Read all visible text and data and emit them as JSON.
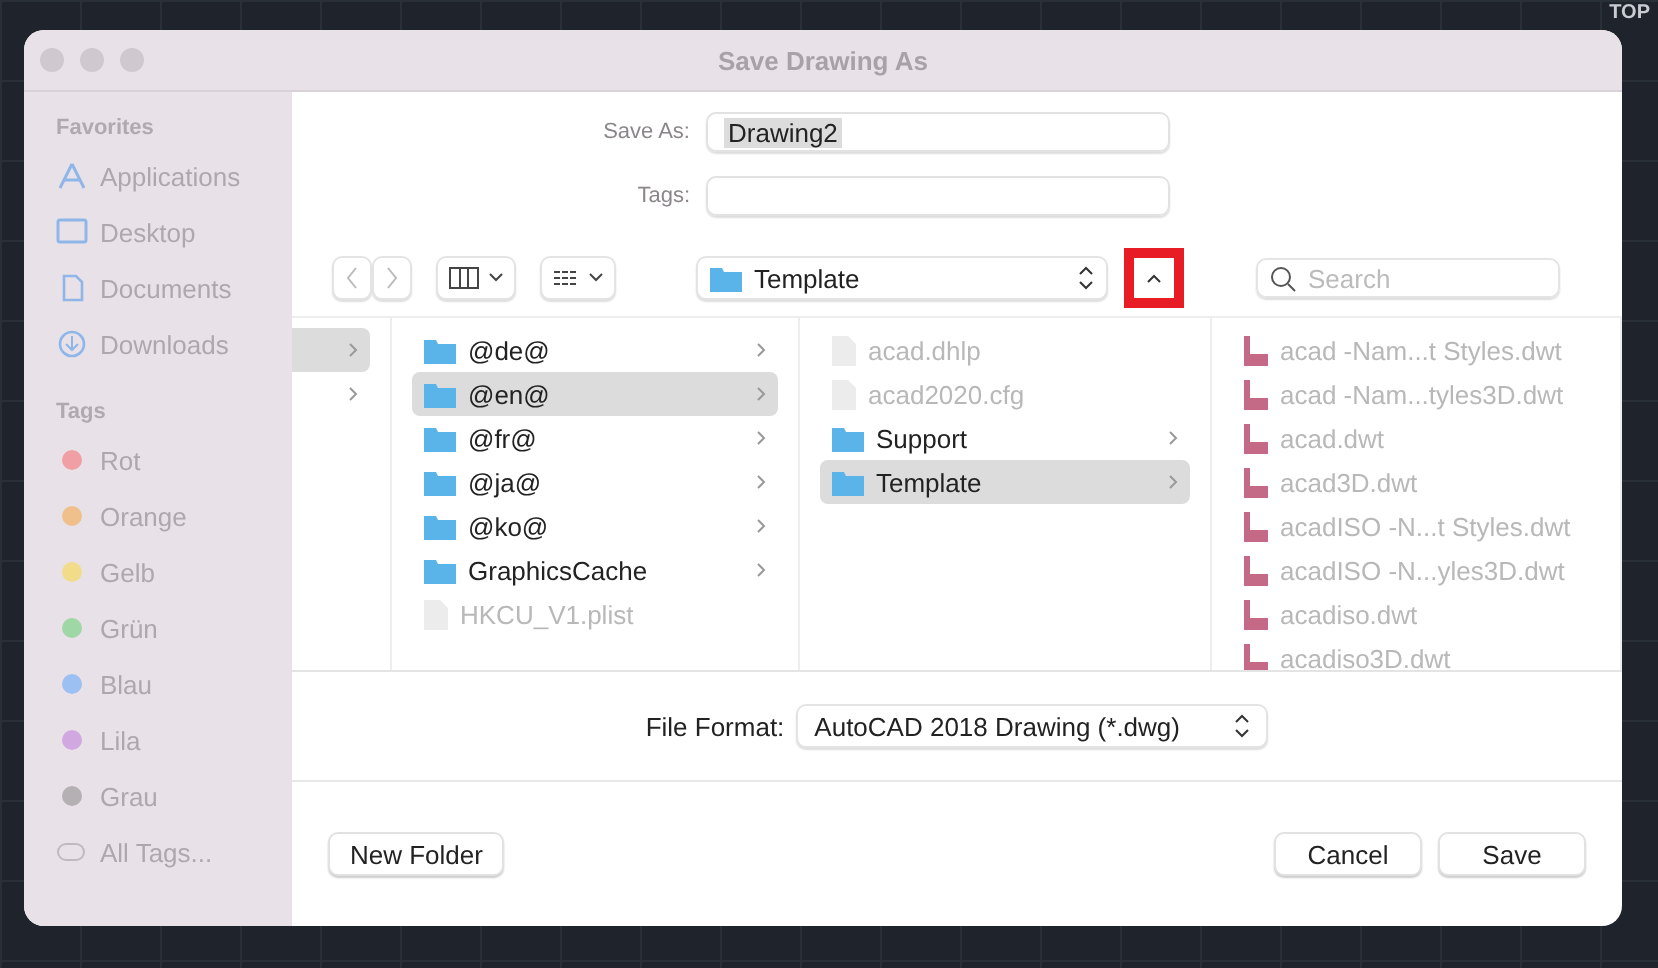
{
  "backdrop": {
    "labels": [
      "TOP"
    ]
  },
  "window": {
    "title": "Save Drawing As"
  },
  "sidebar": {
    "sections": [
      {
        "heading": "Favorites",
        "items": [
          {
            "label": "Applications"
          },
          {
            "label": "Desktop"
          },
          {
            "label": "Documents"
          },
          {
            "label": "Downloads"
          }
        ]
      },
      {
        "heading": "Tags",
        "items": [
          {
            "label": "Rot",
            "color": "#f0a0a4"
          },
          {
            "label": "Orange",
            "color": "#f0c08c"
          },
          {
            "label": "Gelb",
            "color": "#f2dc8a"
          },
          {
            "label": "Grün",
            "color": "#9fd8a6"
          },
          {
            "label": "Blau",
            "color": "#9cc0f2"
          },
          {
            "label": "Lila",
            "color": "#d2a8e0"
          },
          {
            "label": "Grau",
            "color": "#b4b0b4"
          },
          {
            "label": "All Tags..."
          }
        ]
      }
    ]
  },
  "save_as": {
    "label": "Save As:",
    "value": "Drawing2"
  },
  "tags": {
    "label": "Tags:"
  },
  "toolbar": {
    "location": "Template",
    "search_placeholder": "Search",
    "up_highlighted": true
  },
  "columns": [
    [
      {
        "kind": "folder",
        "selected": true
      },
      {
        "kind": "folder",
        "selected": false
      }
    ],
    [
      {
        "label": "@de@",
        "kind": "folder",
        "selected": false,
        "disabled": false
      },
      {
        "label": "@en@",
        "kind": "folder",
        "selected": true,
        "disabled": false
      },
      {
        "label": "@fr@",
        "kind": "folder",
        "selected": false,
        "disabled": false
      },
      {
        "label": "@ja@",
        "kind": "folder",
        "selected": false,
        "disabled": false
      },
      {
        "label": "@ko@",
        "kind": "folder",
        "selected": false,
        "disabled": false
      },
      {
        "label": "GraphicsCache",
        "kind": "folder",
        "selected": false,
        "disabled": false
      },
      {
        "label": "HKCU_V1.plist",
        "kind": "file",
        "selected": false,
        "disabled": true
      }
    ],
    [
      {
        "label": "acad.dhlp",
        "kind": "file",
        "selected": false,
        "disabled": true
      },
      {
        "label": "acad2020.cfg",
        "kind": "file",
        "selected": false,
        "disabled": true
      },
      {
        "label": "Support",
        "kind": "folder",
        "selected": false,
        "disabled": false
      },
      {
        "label": "Template",
        "kind": "folder",
        "selected": true,
        "disabled": false
      }
    ],
    [
      {
        "label": "acad -Nam...t Styles.dwt",
        "kind": "template",
        "selected": false,
        "disabled": true
      },
      {
        "label": "acad -Nam...tyles3D.dwt",
        "kind": "template",
        "selected": false,
        "disabled": true
      },
      {
        "label": "acad.dwt",
        "kind": "template",
        "selected": false,
        "disabled": true
      },
      {
        "label": "acad3D.dwt",
        "kind": "template",
        "selected": false,
        "disabled": true
      },
      {
        "label": "acadISO -N...t Styles.dwt",
        "kind": "template",
        "selected": false,
        "disabled": true
      },
      {
        "label": "acadISO -N...yles3D.dwt",
        "kind": "template",
        "selected": false,
        "disabled": true
      },
      {
        "label": "acadiso.dwt",
        "kind": "template",
        "selected": false,
        "disabled": true
      },
      {
        "label": "acadiso3D.dwt",
        "kind": "template",
        "selected": false,
        "disabled": true
      }
    ]
  ],
  "file_format": {
    "label": "File Format:",
    "value": "AutoCAD 2018 Drawing (*.dwg)"
  },
  "buttons": {
    "new_folder": "New Folder",
    "cancel": "Cancel",
    "save": "Save"
  }
}
